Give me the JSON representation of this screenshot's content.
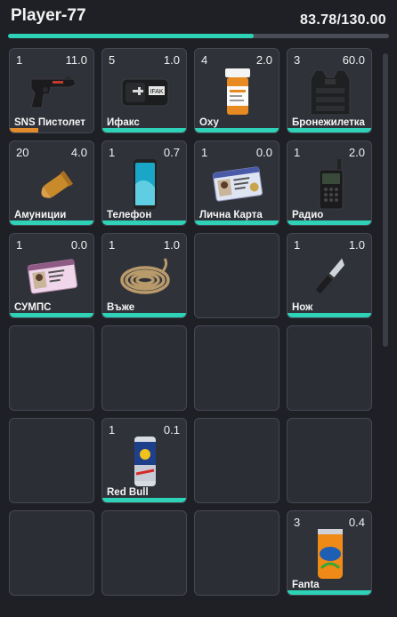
{
  "header": {
    "player_name": "Player-77",
    "weight_text": "83.78/130.00",
    "weight_fraction": 0.6445
  },
  "colors": {
    "accent": "#2ed3b7",
    "warning": "#e38b2c",
    "background": "#1f2026"
  },
  "slots": [
    {
      "count": "1",
      "weight": "11.0",
      "label": "SNS Пистолет",
      "icon": "pistol-icon",
      "durability": "low"
    },
    {
      "count": "5",
      "weight": "1.0",
      "label": "Ифакс",
      "icon": "ifak-icon",
      "durability": "full"
    },
    {
      "count": "4",
      "weight": "2.0",
      "label": "Оху",
      "icon": "pill-bottle-icon",
      "durability": "full"
    },
    {
      "count": "3",
      "weight": "60.0",
      "label": "Бронежилетка",
      "icon": "armor-vest-icon",
      "durability": "full"
    },
    {
      "count": "20",
      "weight": "4.0",
      "label": "Амуниции",
      "icon": "bullet-icon",
      "durability": "full"
    },
    {
      "count": "1",
      "weight": "0.7",
      "label": "Телефон",
      "icon": "phone-icon",
      "durability": "full"
    },
    {
      "count": "1",
      "weight": "0.0",
      "label": "Лична Карта",
      "icon": "id-card-icon",
      "durability": "full"
    },
    {
      "count": "1",
      "weight": "2.0",
      "label": "Радио",
      "icon": "radio-icon",
      "durability": "full"
    },
    {
      "count": "1",
      "weight": "0.0",
      "label": "СУМПС",
      "icon": "license-card-icon",
      "durability": "full"
    },
    {
      "count": "1",
      "weight": "1.0",
      "label": "Въже",
      "icon": "rope-icon",
      "durability": "full"
    },
    null,
    {
      "count": "1",
      "weight": "1.0",
      "label": "Нож",
      "icon": "knife-icon",
      "durability": "full"
    },
    null,
    null,
    null,
    null,
    null,
    {
      "count": "1",
      "weight": "0.1",
      "label": "Red Bull",
      "icon": "energy-drink-can-icon",
      "durability": "full"
    },
    null,
    null,
    null,
    null,
    null,
    {
      "count": "3",
      "weight": "0.4",
      "label": "Fanta",
      "icon": "soda-can-icon",
      "durability": "full"
    }
  ]
}
